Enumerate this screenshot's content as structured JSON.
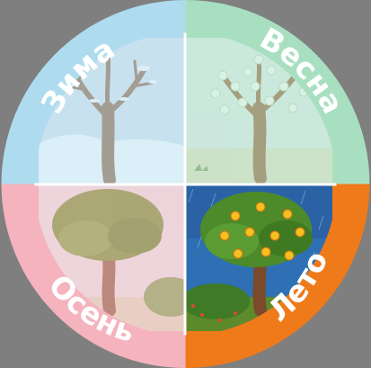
{
  "seasons": {
    "winter": {
      "label": "Зима",
      "ring_color": "#aedcee",
      "active": false
    },
    "spring": {
      "label": "Весна",
      "ring_color": "#a9dfc1",
      "active": false
    },
    "autumn": {
      "label": "Осень",
      "ring_color": "#f5b3be",
      "active": false
    },
    "summer": {
      "label": "Лето",
      "ring_color": "#ef7a1a",
      "active": true
    }
  },
  "colors": {
    "background": "#7f7f7f",
    "divider": "#ffffff"
  }
}
